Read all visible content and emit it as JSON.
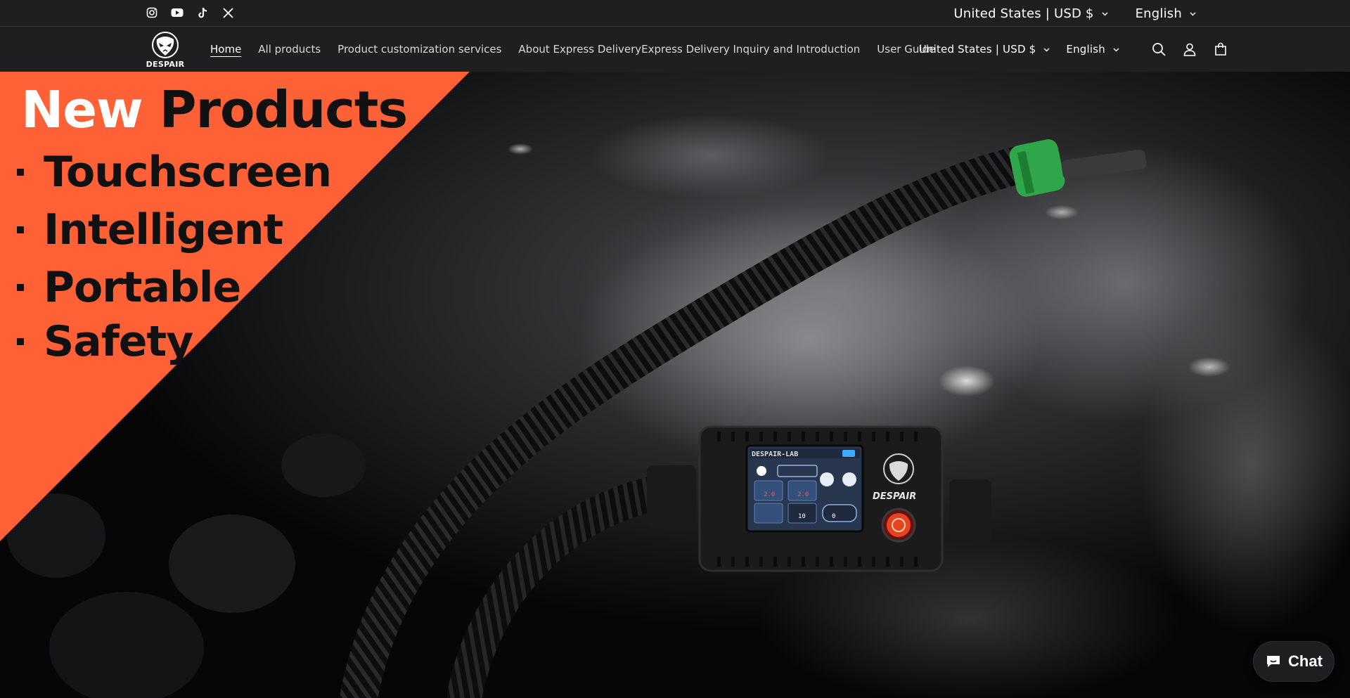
{
  "topbar": {
    "social": [
      {
        "icon": "instagram-icon"
      },
      {
        "icon": "youtube-icon"
      },
      {
        "icon": "tiktok-icon"
      },
      {
        "icon": "x-twitter-icon"
      }
    ],
    "country_label": "United States | USD $",
    "language_label": "English"
  },
  "header": {
    "logo_text": "DESPAIR",
    "nav": [
      {
        "label": "Home",
        "active": true
      },
      {
        "label": "All products",
        "active": false
      },
      {
        "label": "Product customization services",
        "active": false
      },
      {
        "label": "About Express DeliveryExpress Delivery Inquiry and Introduction",
        "active": false
      },
      {
        "label": "User Guide",
        "active": false
      }
    ],
    "country_label": "United States | USD $",
    "language_label": "English",
    "icons": [
      "search-icon",
      "account-icon",
      "cart-icon"
    ]
  },
  "hero": {
    "title_word_1": "New",
    "title_word_2": "Products",
    "bullets": [
      "Touchscreen",
      "Intelligent",
      "Portable",
      "Safety"
    ],
    "banner_color": "#ff6136",
    "device": {
      "screen_title": "DESPAIR-LAB",
      "brand": "DESPAIR",
      "value_1": "2.0",
      "value_2": "2.0",
      "value_3": "10",
      "value_4": "0"
    }
  },
  "chat": {
    "label": "Chat",
    "icon": "chat-bubble-icon"
  }
}
